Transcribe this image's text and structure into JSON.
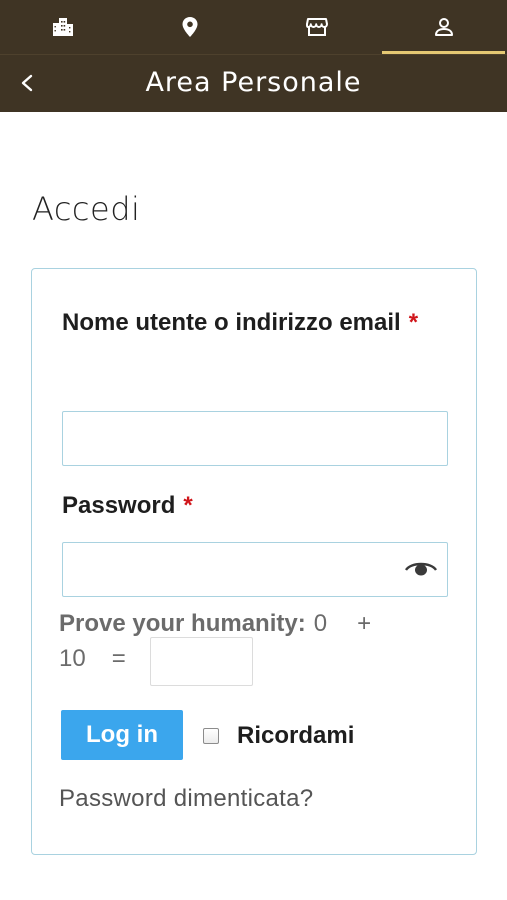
{
  "tabs": [
    {
      "icon": "building-icon",
      "active": false
    },
    {
      "icon": "location-pin-icon",
      "active": false
    },
    {
      "icon": "store-icon",
      "active": false
    },
    {
      "icon": "user-icon",
      "active": true
    }
  ],
  "header": {
    "back_label": "<",
    "title": "Area Personale"
  },
  "page": {
    "title": "Accedi"
  },
  "form": {
    "username_label": "Nome utente o indirizzo email",
    "username_value": "",
    "password_label": "Password",
    "password_value": "",
    "required_mark": "*",
    "humanity_label": "Prove your humanity:",
    "humanity_a": "0",
    "humanity_op": "+",
    "humanity_b": "10",
    "humanity_eq": "=",
    "captcha_value": "",
    "login_label": "Log in",
    "remember_label": "Ricordami",
    "remember_checked": false,
    "forgot_label": "Password dimenticata?"
  },
  "colors": {
    "bar_bg": "#3f3424",
    "tab_active_underline": "#e5c873",
    "input_border": "#a9d2e0",
    "button_bg": "#3ba6ed",
    "required": "#d0161b"
  }
}
